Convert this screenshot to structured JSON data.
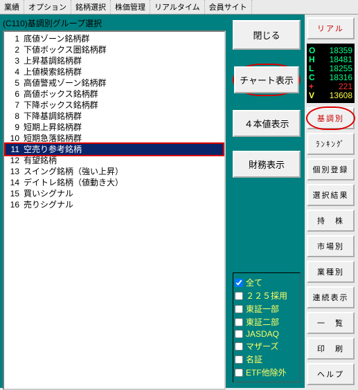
{
  "topmenu": [
    "業績",
    "オプション",
    "銘柄選択",
    "株価管理",
    "リアルタイム",
    "会員サイト"
  ],
  "window_title": "(C110)基調別グループ選択",
  "list": [
    {
      "n": 1,
      "t": "底値ゾーン銘柄群"
    },
    {
      "n": 2,
      "t": "下値ボックス圏銘柄群"
    },
    {
      "n": 3,
      "t": "上昇基調銘柄群"
    },
    {
      "n": 4,
      "t": "上値模索銘柄群"
    },
    {
      "n": 5,
      "t": "高値警戒ゾーン銘柄群"
    },
    {
      "n": 6,
      "t": "高値ボックス銘柄群"
    },
    {
      "n": 7,
      "t": "下降ボックス銘柄群"
    },
    {
      "n": 8,
      "t": "下降基調銘柄群"
    },
    {
      "n": 9,
      "t": "短期上昇銘柄群"
    },
    {
      "n": 10,
      "t": "短期急落銘柄群"
    },
    {
      "n": 11,
      "t": "空売り参考銘柄"
    },
    {
      "n": 12,
      "t": "有望銘柄"
    },
    {
      "n": 13,
      "t": "スイング銘柄（強い上昇）"
    },
    {
      "n": 14,
      "t": "デイトレ銘柄（値動き大）"
    },
    {
      "n": 15,
      "t": "買いシグナル"
    },
    {
      "n": 16,
      "t": "売りシグナル"
    }
  ],
  "selected_index": 10,
  "mid_buttons": {
    "close": "閉じる",
    "chart": "チャート表示",
    "fourval": "４本値表示",
    "finance": "財務表示"
  },
  "checks": [
    {
      "label": "全て",
      "checked": true
    },
    {
      "label": "２２５採用",
      "checked": false
    },
    {
      "label": "東証一部",
      "checked": false
    },
    {
      "label": "東証二部",
      "checked": false
    },
    {
      "label": "JASDAQ",
      "checked": false
    },
    {
      "label": "マザーズ",
      "checked": false
    },
    {
      "label": "名証",
      "checked": false
    },
    {
      "label": "ETF他除外",
      "checked": false
    }
  ],
  "right": {
    "real": "リアル",
    "quotes": [
      {
        "k": "O",
        "v": "18359",
        "c": "#00ff88"
      },
      {
        "k": "H",
        "v": "18481",
        "c": "#00ff88"
      },
      {
        "k": "L",
        "v": "18255",
        "c": "#00ff88"
      },
      {
        "k": "C",
        "v": "18316",
        "c": "#00ff88"
      },
      {
        "k": "+",
        "v": "221",
        "c": "#ff3030"
      },
      {
        "k": "V",
        "v": "13608",
        "c": "#ffff44"
      }
    ],
    "buttons": [
      "基調別",
      "ﾗﾝｷﾝｸﾞ",
      "個別登録",
      "選択結果",
      "持　株",
      "市場別",
      "業種別",
      "連続表示",
      "一　覧",
      "印　刷",
      "ヘルプ"
    ]
  }
}
